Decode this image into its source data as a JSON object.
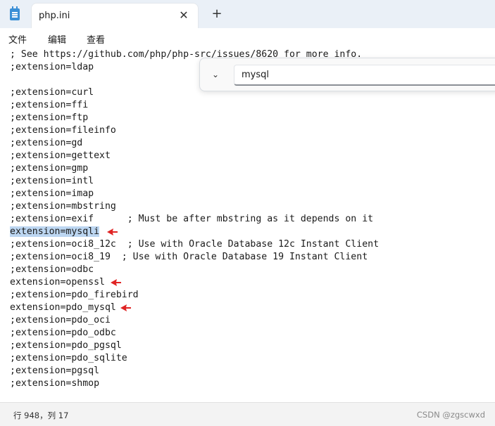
{
  "tab": {
    "title": "php.ini",
    "close_glyph": "✕",
    "new_tab_glyph": "+"
  },
  "menu": {
    "items": [
      "文件",
      "编辑",
      "查看"
    ]
  },
  "find": {
    "value": "mysql",
    "toggle_glyph": "⌄"
  },
  "editor": {
    "lines": [
      "; See https://github.com/php/php-src/issues/8620 for more info.",
      ";extension=ldap",
      "",
      ";extension=curl",
      ";extension=ffi",
      ";extension=ftp",
      ";extension=fileinfo",
      ";extension=gd",
      ";extension=gettext",
      ";extension=gmp",
      ";extension=intl",
      ";extension=imap",
      ";extension=mbstring",
      ";extension=exif      ; Must be after mbstring as it depends on it",
      "extension=mysqli",
      ";extension=oci8_12c  ; Use with Oracle Database 12c Instant Client",
      ";extension=oci8_19  ; Use with Oracle Database 19 Instant Client",
      ";extension=odbc",
      "extension=openssl",
      ";extension=pdo_firebird",
      "extension=pdo_mysql",
      ";extension=pdo_oci",
      ";extension=pdo_odbc",
      ";extension=pdo_pgsql",
      ";extension=pdo_sqlite",
      ";extension=pgsql",
      ";extension=shmop"
    ],
    "selected_line_index": 14,
    "arrow_color": "#e02424"
  },
  "status": {
    "position": "行 948，列 17",
    "watermark": "CSDN @zgscwxd"
  },
  "icons": {
    "app": "notepad-icon",
    "close": "close-icon",
    "new_tab": "plus-icon",
    "find_toggle": "chevron-down-icon",
    "annotation": "red-arrow-icon"
  }
}
